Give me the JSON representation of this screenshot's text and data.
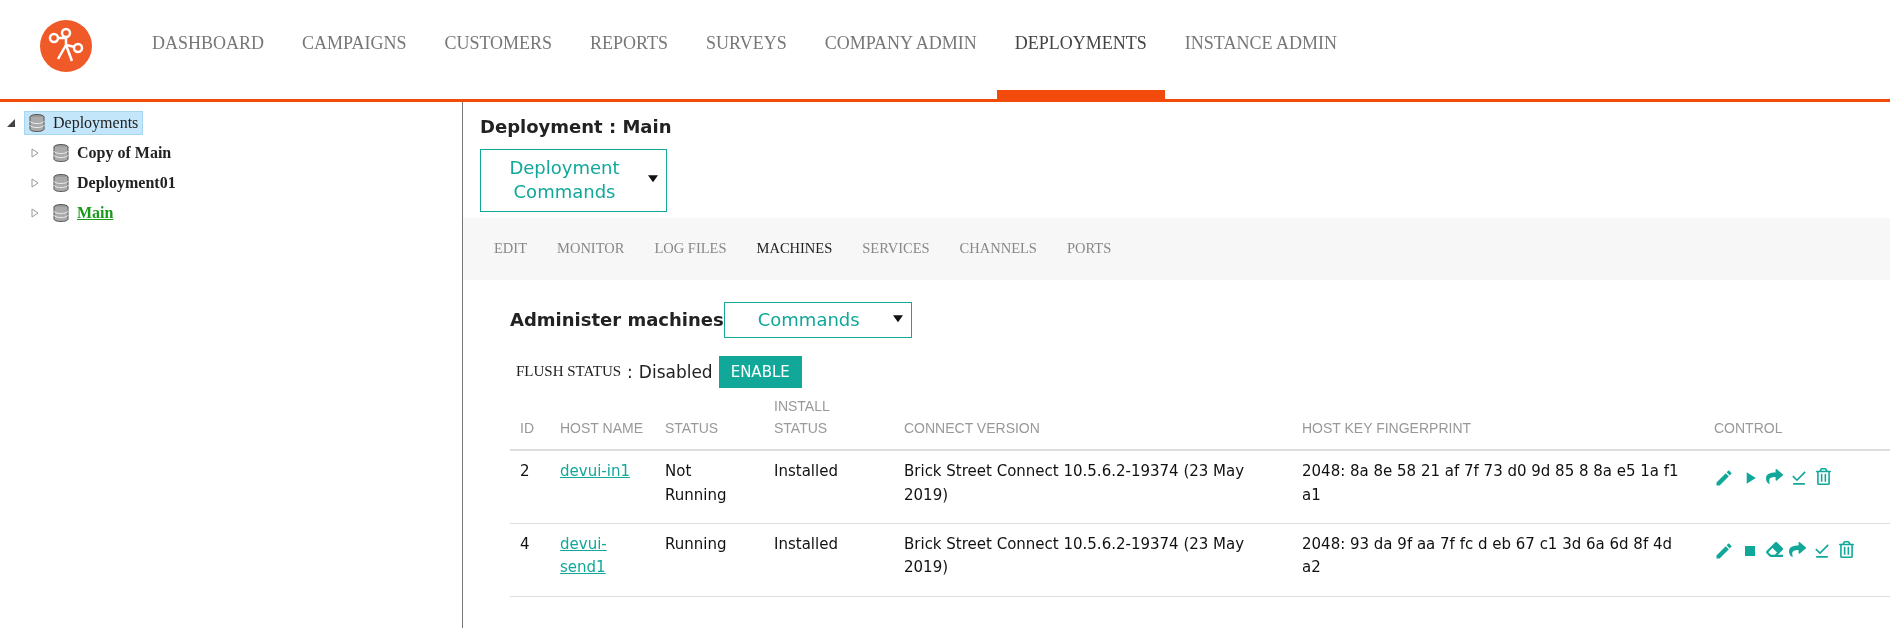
{
  "nav": {
    "items": [
      {
        "label": "DASHBOARD",
        "selected": false
      },
      {
        "label": "CAMPAIGNS",
        "selected": false
      },
      {
        "label": "CUSTOMERS",
        "selected": false
      },
      {
        "label": "REPORTS",
        "selected": false
      },
      {
        "label": "SURVEYS",
        "selected": false
      },
      {
        "label": "COMPANY ADMIN",
        "selected": false
      },
      {
        "label": "DEPLOYMENTS",
        "selected": true
      },
      {
        "label": "INSTANCE ADMIN",
        "selected": false
      }
    ]
  },
  "tree": {
    "label": "Deployments",
    "expanded": true,
    "selected": true,
    "children": [
      {
        "label": "Copy of Main",
        "expanded": false,
        "active": false
      },
      {
        "label": "Deployment01",
        "expanded": false,
        "active": false
      },
      {
        "label": "Main",
        "expanded": false,
        "active": true
      }
    ]
  },
  "title": "Deployment : Main",
  "deployment_commands": "Deployment Commands",
  "tabs": [
    {
      "label": "EDIT",
      "selected": false
    },
    {
      "label": "MONITOR",
      "selected": false
    },
    {
      "label": "LOG FILES",
      "selected": false
    },
    {
      "label": "MACHINES",
      "selected": true
    },
    {
      "label": "SERVICES",
      "selected": false
    },
    {
      "label": "CHANNELS",
      "selected": false
    },
    {
      "label": "PORTS",
      "selected": false
    }
  ],
  "section_title": "Administer machines",
  "commands": "Commands",
  "flush": {
    "label": "FLUSH STATUS",
    "separator": ":",
    "value": "Disabled",
    "button": "ENABLE"
  },
  "table": {
    "columns": [
      "ID",
      "HOST NAME",
      "STATUS",
      "INSTALL STATUS",
      "CONNECT VERSION",
      "HOST KEY FINGERPRINT",
      "CONTROL"
    ],
    "rows": [
      {
        "id": "2",
        "host": "devui-in1",
        "status": "Not Running",
        "install": "Installed",
        "version": "Brick Street Connect 10.5.6.2-19374 (23 May 2019)",
        "fingerprint": "2048: 8a 8e 58 21 af 7f 73 d0 9d 85 8 8a e5 1a f1 a1",
        "controls": [
          {
            "kind": "edit"
          },
          {
            "kind": "start"
          },
          {
            "kind": "forward"
          },
          {
            "kind": "install"
          },
          {
            "kind": "delete"
          }
        ]
      },
      {
        "id": "4",
        "host": "devui-send1",
        "status": "Running",
        "install": "Installed",
        "version": "Brick Street Connect 10.5.6.2-19374 (23 May 2019)",
        "fingerprint": "2048: 93 da 9f aa 7f fc d eb 67 c1 3d 6a 6d 8f 4d a2",
        "controls": [
          {
            "kind": "edit"
          },
          {
            "kind": "stop"
          },
          {
            "kind": "clear"
          },
          {
            "kind": "forward"
          },
          {
            "kind": "install"
          },
          {
            "kind": "delete"
          }
        ]
      }
    ]
  }
}
